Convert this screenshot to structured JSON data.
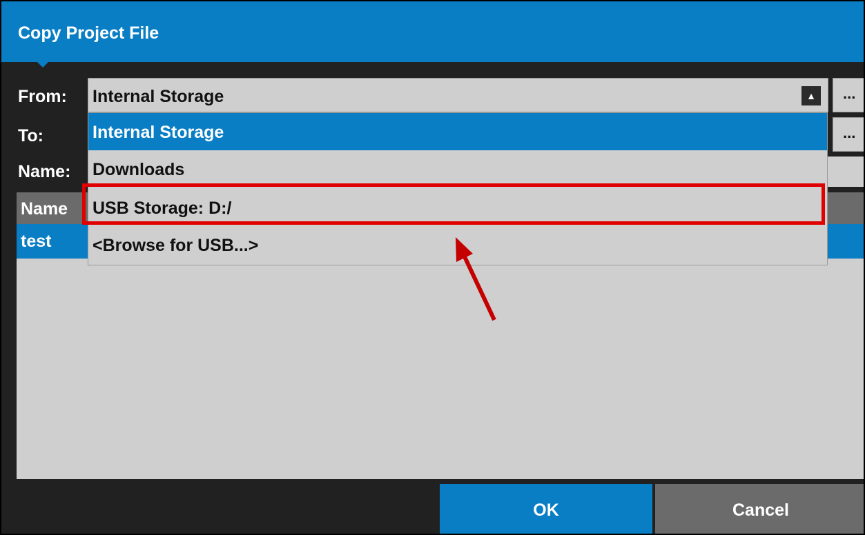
{
  "dialog": {
    "title": "Copy Project File"
  },
  "form": {
    "from_label": "From:",
    "from_value": "Internal Storage",
    "to_label": "To:",
    "name_label": "Name:",
    "browse_button": "..."
  },
  "dropdown": {
    "options": [
      "Internal Storage",
      "Downloads",
      "USB Storage: D:/",
      "<Browse for USB...>"
    ],
    "selected": "Internal Storage",
    "highlighted": "USB Storage: D:/"
  },
  "file_list": {
    "column_name": "Name",
    "rows": [
      "test"
    ]
  },
  "buttons": {
    "ok": "OK",
    "cancel": "Cancel"
  },
  "colors": {
    "accent": "#0a7ec5",
    "background": "#212121",
    "field": "#cfcfcf",
    "annotation": "#e00000"
  }
}
